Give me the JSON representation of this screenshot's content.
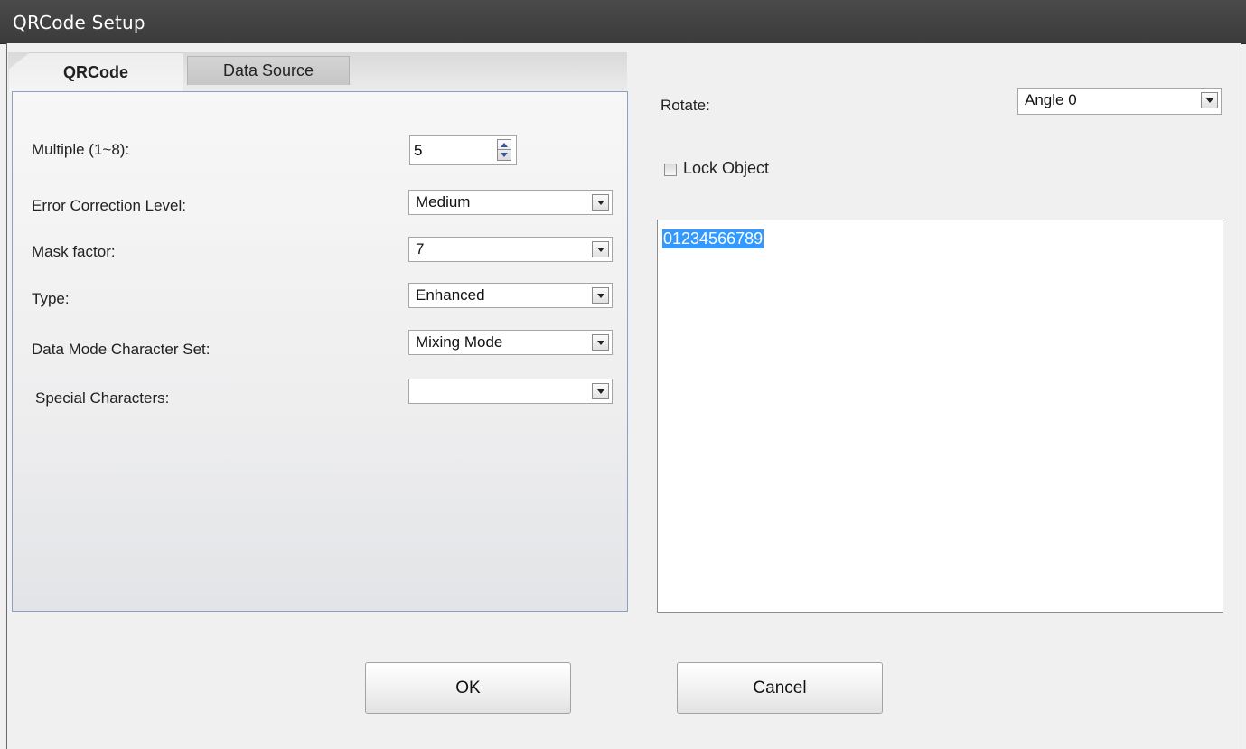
{
  "window": {
    "title": "QRCode Setup"
  },
  "tabs": [
    {
      "label": "QRCode",
      "active": true
    },
    {
      "label": "Data Source",
      "active": false
    }
  ],
  "qrcode": {
    "multiple_label": "Multiple (1~8):",
    "multiple_value": "5",
    "ecl_label": "Error Correction Level:",
    "ecl_value": "Medium",
    "mask_label": "Mask factor:",
    "mask_value": "7",
    "type_label": "Type:",
    "type_value": "Enhanced",
    "datamode_label": "Data Mode Character Set:",
    "datamode_value": "Mixing Mode",
    "special_label": "Special Characters:",
    "special_value": ""
  },
  "right": {
    "rotate_label": "Rotate:",
    "rotate_value": "Angle 0",
    "lock_label": "Lock Object",
    "lock_checked": false,
    "data_text": "01234566789"
  },
  "buttons": {
    "ok": "OK",
    "cancel": "Cancel"
  },
  "colors": {
    "titlebar": "#3b3b3b",
    "selection": "#3399ff",
    "panel_border": "#8aa0c6"
  }
}
